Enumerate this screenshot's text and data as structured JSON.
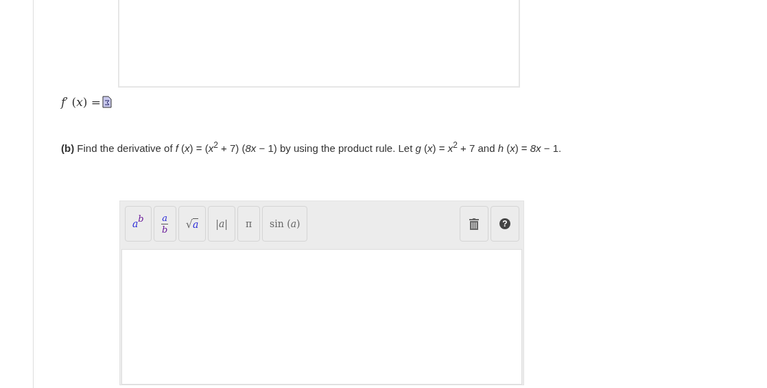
{
  "answer_label": "*f*′ (*x*) =",
  "question": "**(b)** Find the derivative of *f* (*x*) = (*x*$^{2}$ + 7) (*8x* − 1) by using the product rule. Let *g* (*x*) = *x*$^{2}$ + 7 and *h* (*x*) = *8x* − 1.",
  "toolbar": [
    {
      "kind": "power",
      "base": "a",
      "exponent": "b"
    },
    {
      "kind": "fraction",
      "numerator": "a",
      "denominator": "b"
    },
    {
      "kind": "sqrt",
      "sign": "√",
      "radicand": "a"
    },
    {
      "kind": "text",
      "label": "|*a*|"
    },
    {
      "kind": "text",
      "label": "π"
    },
    {
      "kind": "text",
      "label": "sin (*a*)"
    }
  ],
  "tools": [
    {
      "kind": "trash"
    },
    {
      "kind": "help",
      "label": "?"
    }
  ]
}
